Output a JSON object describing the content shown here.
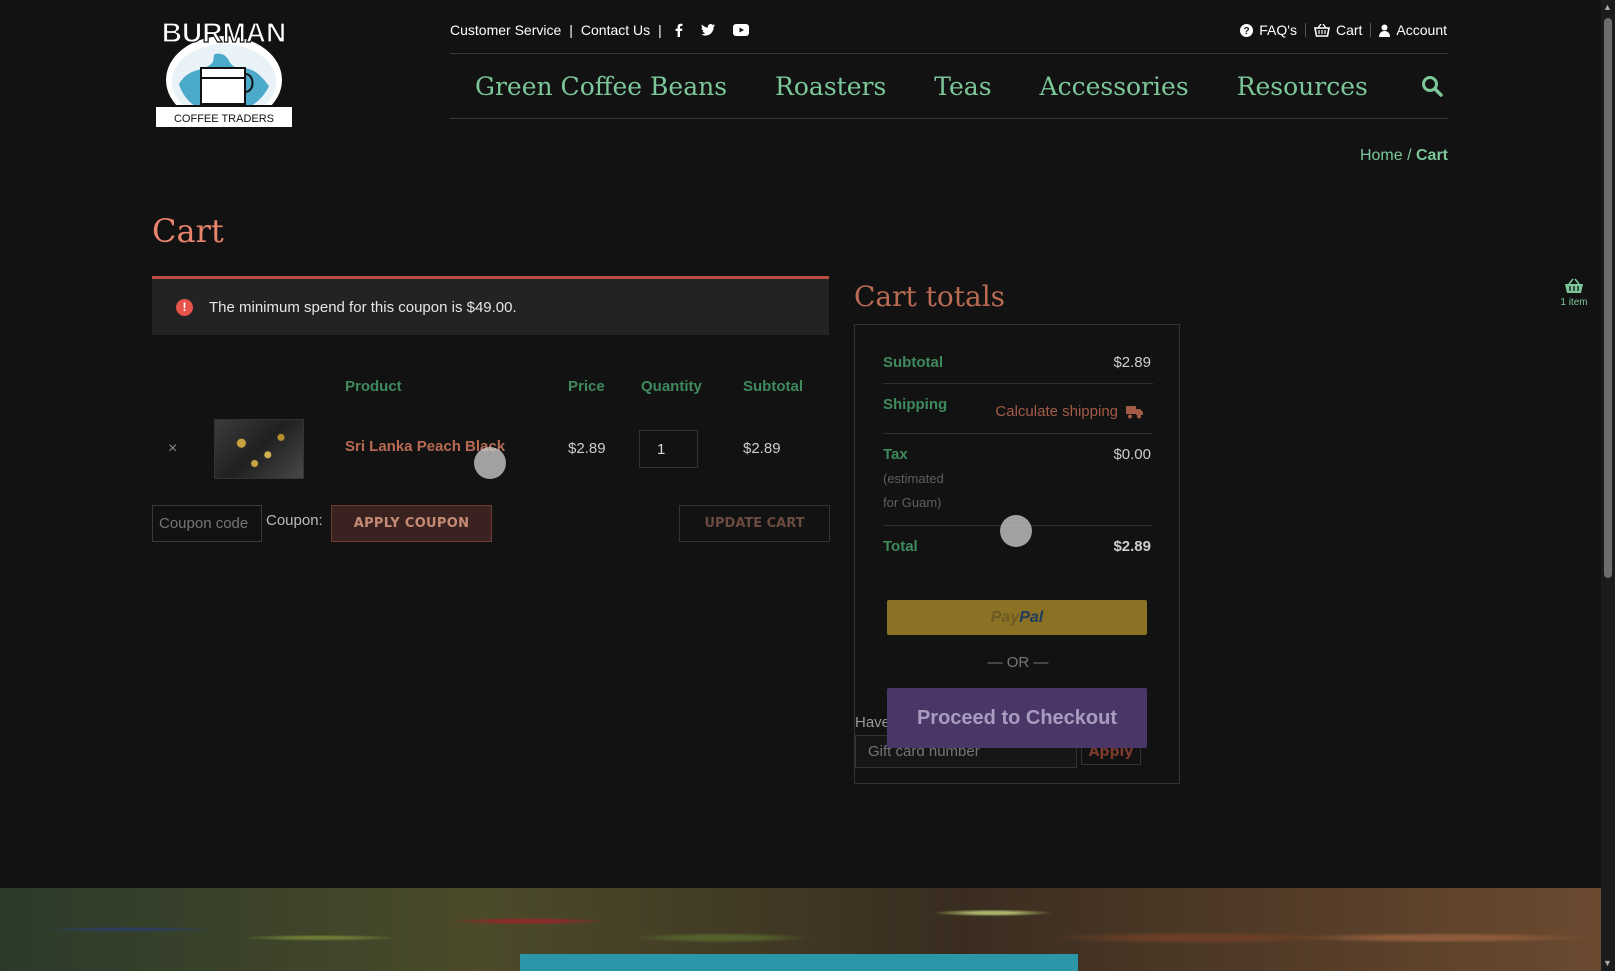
{
  "brand": {
    "name_top": "BURMAN",
    "name_bottom": "COFFEE TRADERS"
  },
  "top_links": {
    "customer_service": "Customer Service",
    "contact_us": "Contact Us",
    "separator": "|"
  },
  "top_right": {
    "faq": "FAQ's",
    "cart": "Cart",
    "account": "Account"
  },
  "nav": {
    "items": [
      {
        "label": "Green Coffee Beans"
      },
      {
        "label": "Roasters"
      },
      {
        "label": "Teas"
      },
      {
        "label": "Accessories"
      },
      {
        "label": "Resources"
      }
    ]
  },
  "breadcrumb": {
    "home": "Home",
    "separator": " / ",
    "current": "Cart"
  },
  "page_title": "Cart",
  "notice": {
    "message": "The minimum spend for this coupon is $49.00.",
    "icon": "!"
  },
  "cart_table": {
    "headers": {
      "product": "Product",
      "price": "Price",
      "quantity": "Quantity",
      "subtotal": "Subtotal"
    },
    "rows": [
      {
        "remove": "×",
        "product": "Sri Lanka Peach Black",
        "price": "$2.89",
        "quantity": "1",
        "subtotal": "$2.89"
      }
    ]
  },
  "coupon": {
    "placeholder": "Coupon code",
    "label": "Coupon:",
    "apply_label": "APPLY COUPON",
    "update_label": "UPDATE CART"
  },
  "totals": {
    "title": "Cart totals",
    "subtotal_label": "Subtotal",
    "subtotal_value": "$2.89",
    "shipping_label": "Shipping",
    "calc_shipping": "Calculate shipping",
    "tax_label": "Tax",
    "tax_note_1": "(estimated",
    "tax_note_2": "for Guam)",
    "tax_value": "$0.00",
    "total_label": "Total",
    "total_value": "$2.89",
    "paypal_1": "Pay",
    "paypal_2": "Pal",
    "or_text": "— OR —",
    "checkout_label": "Proceed to Checkout",
    "giftcard_label": "Have",
    "giftcard_placeholder": "Gift card number",
    "giftcard_apply": "Apply"
  },
  "mini_cart": {
    "count": "1 item"
  },
  "colors": {
    "accent_green": "#7cc79a",
    "title_salmon": "#e8836c",
    "rust": "#b86a53",
    "checkout_purple": "#4a3768"
  }
}
